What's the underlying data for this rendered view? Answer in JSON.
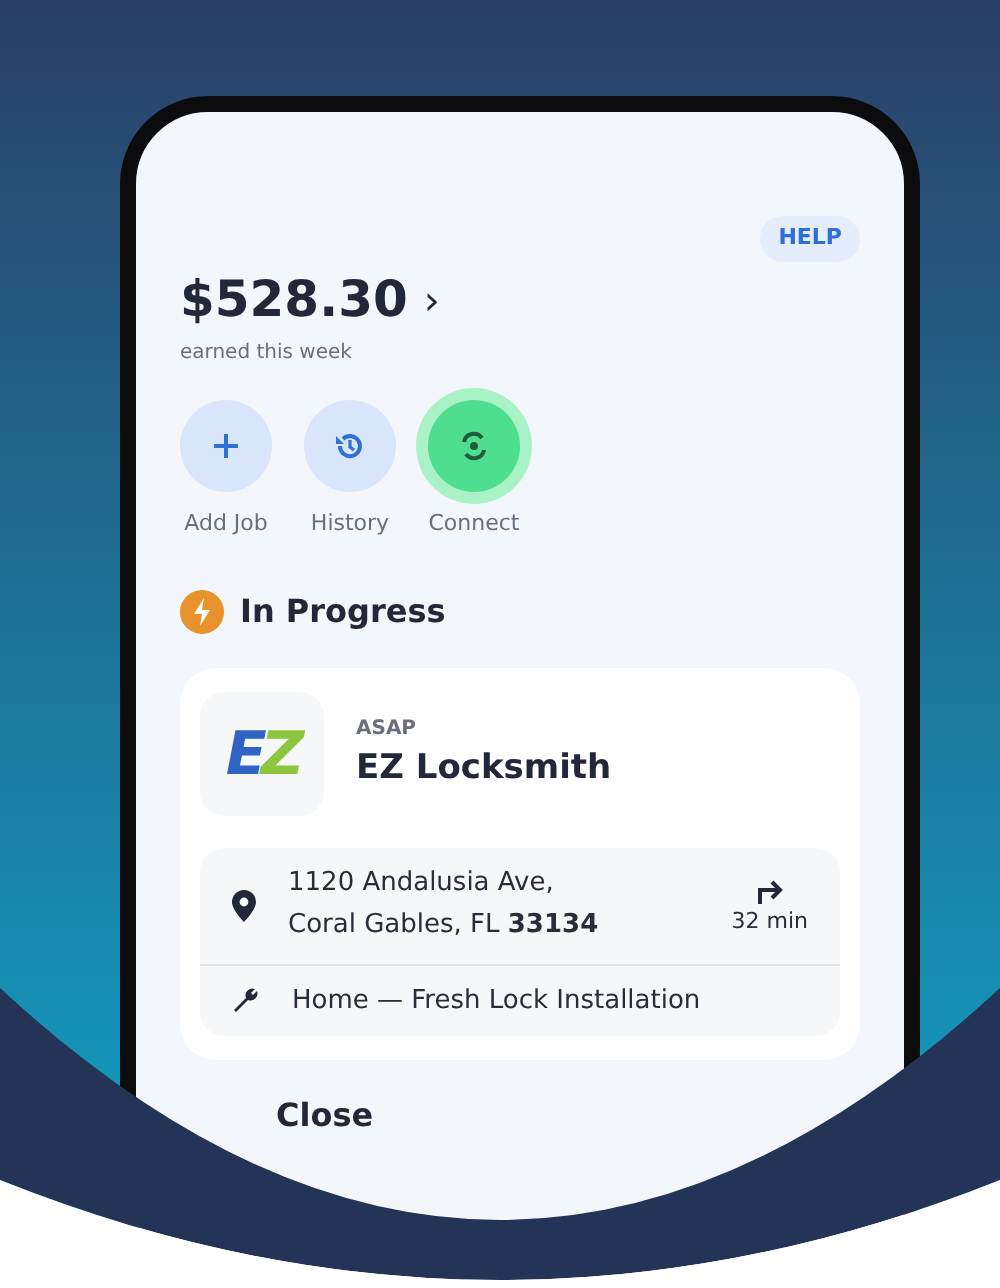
{
  "help": "HELP",
  "earnings": {
    "amount": "$528.30",
    "chevron": "›",
    "caption": "earned this week"
  },
  "actions": [
    {
      "label": "Add Job",
      "kind": "add",
      "highlighted": false
    },
    {
      "label": "History",
      "kind": "history",
      "highlighted": false
    },
    {
      "label": "Connect",
      "kind": "connect",
      "highlighted": true
    }
  ],
  "section": {
    "title": "In Progress"
  },
  "job": {
    "logo": "EZ",
    "tag": "ASAP",
    "company": "EZ Locksmith",
    "address": [
      "1120 Andalusia Ave,",
      "Coral Gables, FL **33134**"
    ],
    "eta": "32 min",
    "service": "Home — Fresh Lock Installation"
  },
  "next_section": {
    "title": "Close"
  }
}
